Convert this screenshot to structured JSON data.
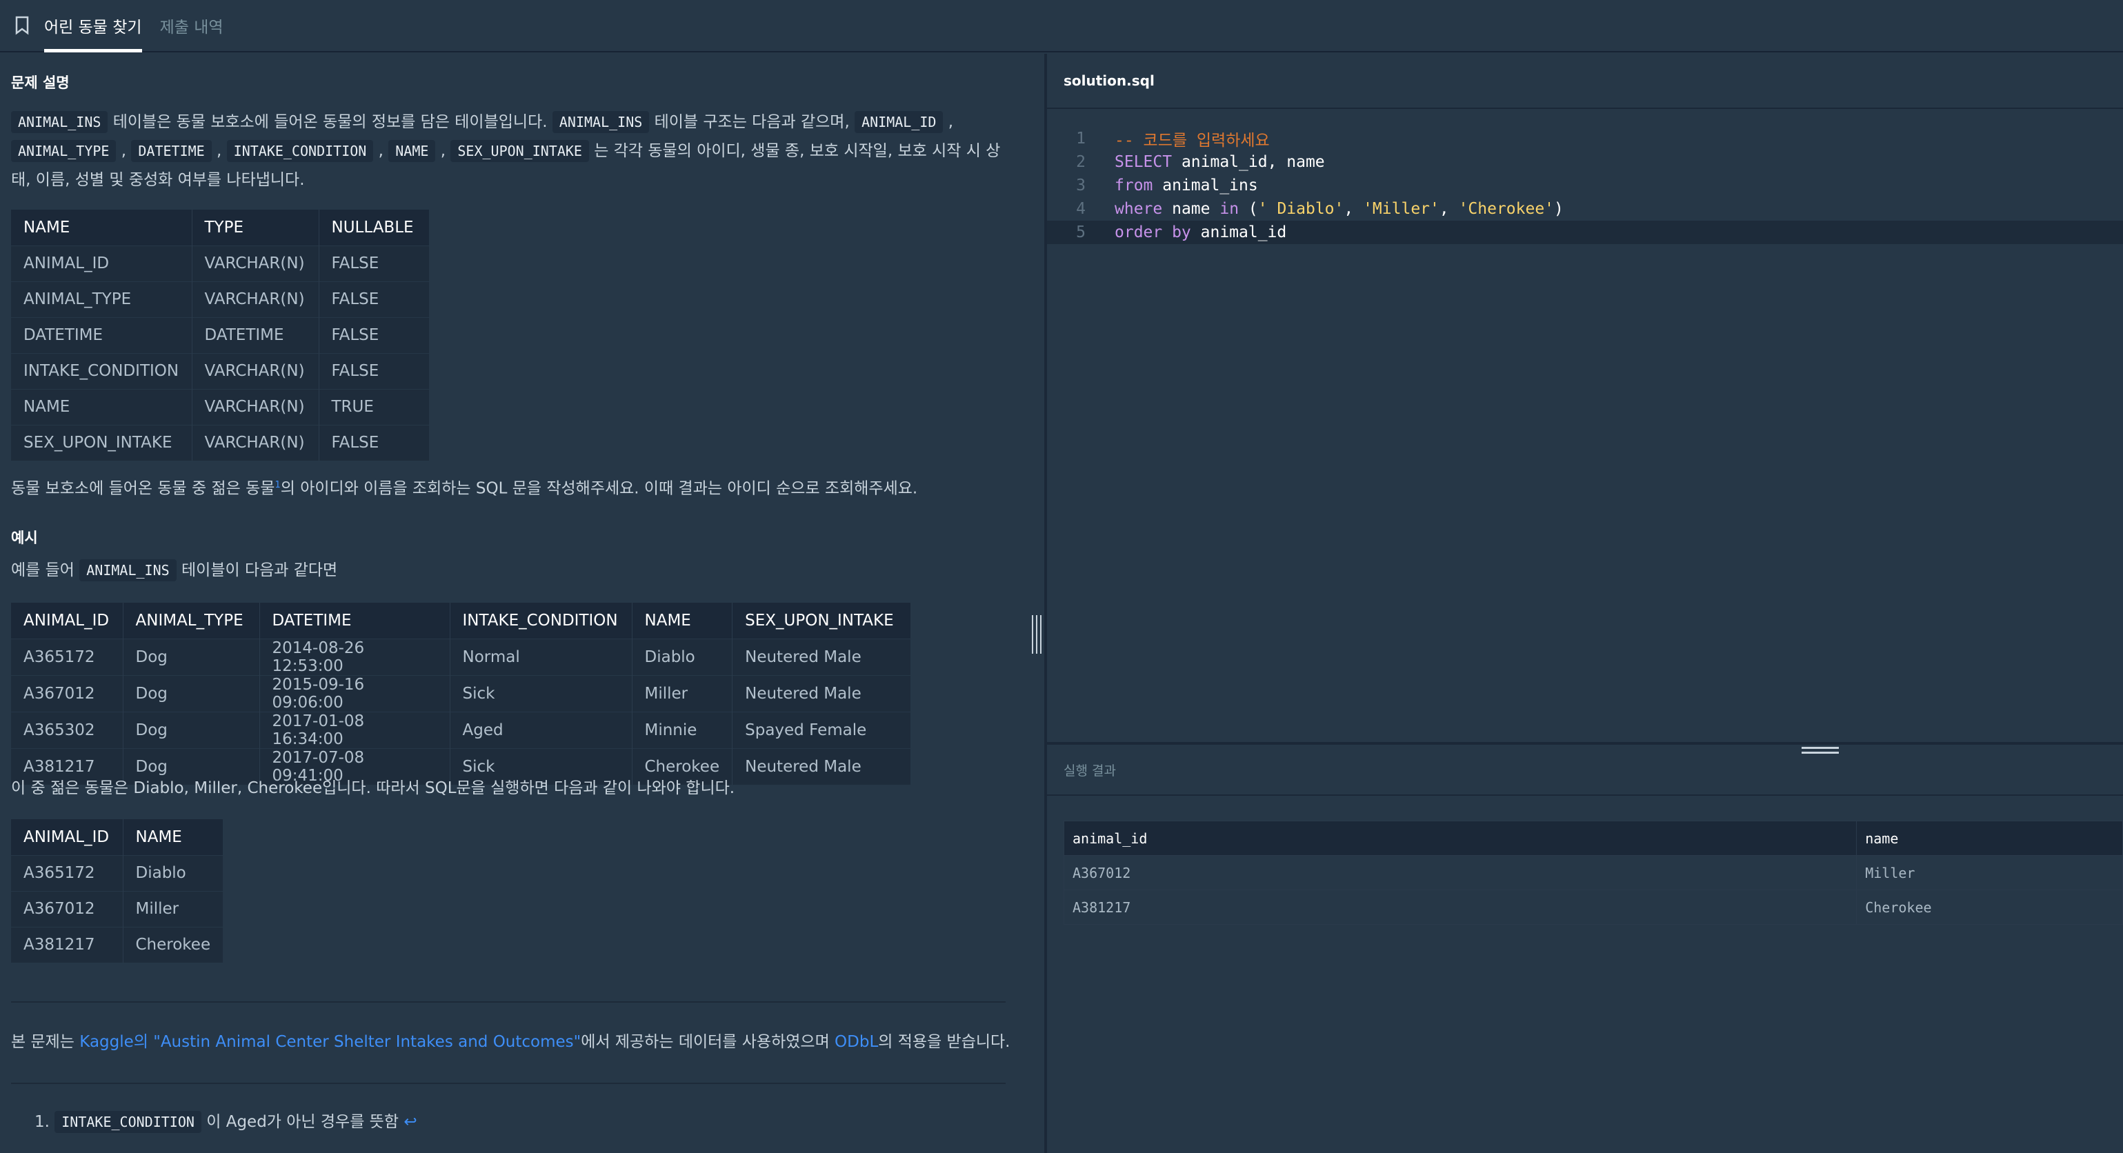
{
  "tabs": {
    "active": "어린 동물 찾기",
    "inactive": "제출 내역",
    "icon": "bookmark-icon"
  },
  "problem": {
    "section_title": "문제 설명",
    "intro": {
      "p1": "테이블은 동물 보호소에 들어온 동물의 정보를 담은 테이블입니다.",
      "p2": "테이블 구조는 다음과 같으며,",
      "p3": "는 각각 동물의 아이디, 생물 종, 보호 시작일, 보호 시작 시 상",
      "p4": "태, 이름, 성별 및 중성화 여부를 나타냅니다.",
      "codes": [
        "ANIMAL_INS",
        "ANIMAL_INS",
        "ANIMAL_ID",
        "ANIMAL_TYPE",
        "DATETIME",
        "INTAKE_CONDITION",
        "NAME",
        "SEX_UPON_INTAKE"
      ]
    },
    "schema_table": {
      "headers": [
        "NAME",
        "TYPE",
        "NULLABLE"
      ],
      "rows": [
        [
          "ANIMAL_ID",
          "VARCHAR(N)",
          "FALSE"
        ],
        [
          "ANIMAL_TYPE",
          "VARCHAR(N)",
          "FALSE"
        ],
        [
          "DATETIME",
          "DATETIME",
          "FALSE"
        ],
        [
          "INTAKE_CONDITION",
          "VARCHAR(N)",
          "FALSE"
        ],
        [
          "NAME",
          "VARCHAR(N)",
          "TRUE"
        ],
        [
          "SEX_UPON_INTAKE",
          "VARCHAR(N)",
          "FALSE"
        ]
      ]
    },
    "task_before": "동물 보호소에 들어온 동물 중 젊은 동물",
    "task_footnote": "1",
    "task_after": "의 아이디와 이름을 조회하는 SQL 문을 작성해주세요. 이때 결과는 아이디 순으로 조회해주세요.",
    "example_title": "예시",
    "example_before": "예를 들어",
    "example_code": "ANIMAL_INS",
    "example_after": "테이블이 다음과 같다면",
    "example_table": {
      "headers": [
        "ANIMAL_ID",
        "ANIMAL_TYPE",
        "DATETIME",
        "INTAKE_CONDITION",
        "NAME",
        "SEX_UPON_INTAKE"
      ],
      "rows": [
        [
          "A365172",
          "Dog",
          "2014-08-26 12:53:00",
          "Normal",
          "Diablo",
          "Neutered Male"
        ],
        [
          "A367012",
          "Dog",
          "2015-09-16 09:06:00",
          "Sick",
          "Miller",
          "Neutered Male"
        ],
        [
          "A365302",
          "Dog",
          "2017-01-08 16:34:00",
          "Aged",
          "Minnie",
          "Spayed Female"
        ],
        [
          "A381217",
          "Dog",
          "2017-07-08 09:41:00",
          "Sick",
          "Cherokee",
          "Neutered Male"
        ]
      ]
    },
    "example_result_text": "이 중 젊은 동물은 Diablo, Miller, Cherokee입니다. 따라서 SQL문을 실행하면 다음과 같이 나와야 합니다.",
    "expected_table": {
      "headers": [
        "ANIMAL_ID",
        "NAME"
      ],
      "rows": [
        [
          "A365172",
          "Diablo"
        ],
        [
          "A367012",
          "Miller"
        ],
        [
          "A381217",
          "Cherokee"
        ]
      ]
    },
    "license_before": "본 문제는",
    "license_link1": "Kaggle의 \"Austin Animal Center Shelter Intakes and Outcomes\"",
    "license_mid": "에서 제공하는 데이터를 사용하였으며",
    "license_link2": "ODbL",
    "license_after": "의 적용을 받습니다.",
    "footnote_num": "1.",
    "footnote_code": "INTAKE_CONDITION",
    "footnote_text": "이 Aged가 아닌 경우를 뜻함",
    "footnote_back": "↩"
  },
  "editor": {
    "filename": "solution.sql",
    "line_numbers": [
      "1",
      "2",
      "3",
      "4",
      "5"
    ],
    "lines": {
      "l1": "-- 코드를 입력하세요",
      "l2_kw": "SELECT",
      "l2_rest": " animal_id, name",
      "l3_kw": "from",
      "l3_rest": " animal_ins",
      "l4_kw": "where",
      "l4_a": " name ",
      "l4_kw2": "in",
      "l4_b": " (",
      "l4_s1": "' Diablo'",
      "l4_c1": ", ",
      "l4_s2": "'Miller'",
      "l4_c2": ", ",
      "l4_s3": "'Cherokee'",
      "l4_end": ")",
      "l5_kw": "order by",
      "l5_rest": " animal_id"
    }
  },
  "result": {
    "title": "실행 결과",
    "headers": [
      "animal_id",
      "name"
    ],
    "rows": [
      [
        "A367012",
        "Miller"
      ],
      [
        "A381217",
        "Cherokee"
      ]
    ]
  }
}
